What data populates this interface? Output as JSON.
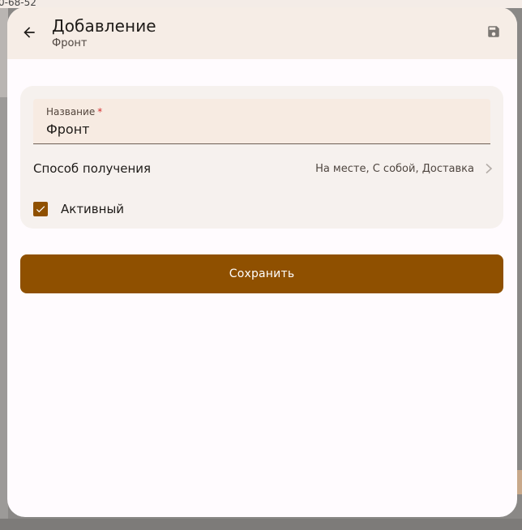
{
  "background": {
    "phone_fragment": "0-68-52"
  },
  "header": {
    "title": "Добавление",
    "subtitle": "Фронт",
    "back_icon": "arrow-left-icon",
    "save_icon": "floppy-disk-icon"
  },
  "form": {
    "name_field": {
      "label": "Название",
      "required_marker": "*",
      "value": "Фронт"
    },
    "method_row": {
      "label": "Способ получения",
      "value": "На месте, С собой, Доставка",
      "chevron_icon": "chevron-right-icon"
    },
    "active_row": {
      "label": "Активный",
      "checked": true,
      "check_icon": "check-icon"
    }
  },
  "actions": {
    "save_label": "Сохранить"
  },
  "colors": {
    "primary": "#8f5000",
    "header_bg": "#f6ede6",
    "card_bg": "#f6f1ee",
    "field_bg": "#f7ebe2"
  }
}
